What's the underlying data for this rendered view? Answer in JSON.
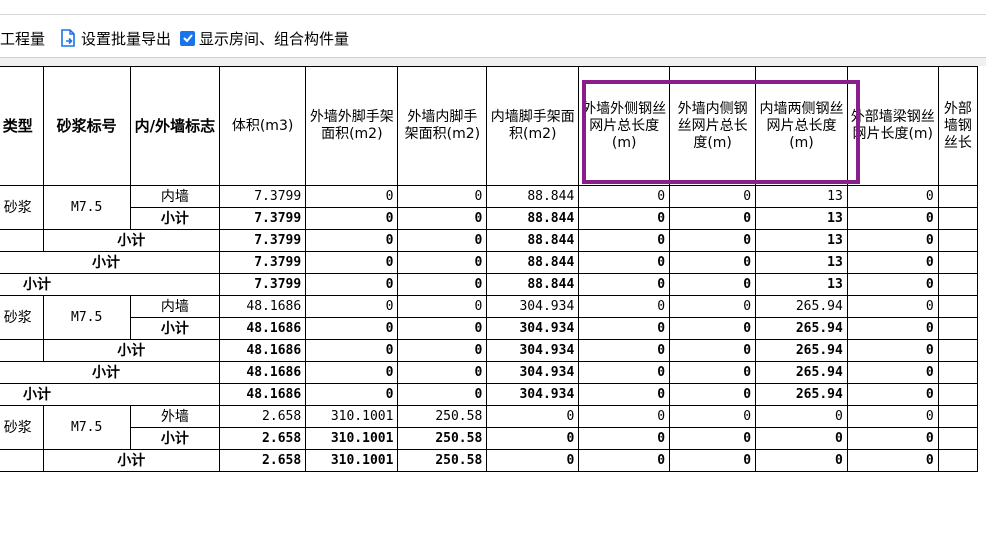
{
  "toolbar": {
    "quantities_label": "工程量",
    "batch_export_label": "设置批量导出",
    "show_rooms_label": "显示房间、组合构件量",
    "show_rooms_checked": true
  },
  "headers": [
    "类型",
    "砂浆标号",
    "内/外墙标志",
    "体积(m3)",
    "外墙外脚手架面积(m2)",
    "外墙内脚手架面积(m2)",
    "内墙脚手架面积(m2)",
    "外墙外侧钢丝网片总长度(m)",
    "外墙内侧钢丝网片总长度(m)",
    "内墙两侧钢丝网片总长度(m)",
    "外部墙梁钢丝网片长度(m)",
    "外部墙钢丝长"
  ],
  "labels": {
    "type_mortar": "砂浆",
    "grade": "M7.5",
    "inner_wall": "内墙",
    "outer_wall": "外墙",
    "subtotal": "小计"
  },
  "group1": {
    "detail": [
      "7.3799",
      "0",
      "0",
      "88.844",
      "0",
      "0",
      "13",
      "0"
    ],
    "subtotal": [
      "7.3799",
      "0",
      "0",
      "88.844",
      "0",
      "0",
      "13",
      "0"
    ]
  },
  "group2": {
    "detail": [
      "48.1686",
      "0",
      "0",
      "304.934",
      "0",
      "0",
      "265.94",
      "0"
    ],
    "subtotal": [
      "48.1686",
      "0",
      "0",
      "304.934",
      "0",
      "0",
      "265.94",
      "0"
    ]
  },
  "group3": {
    "detail": [
      "2.658",
      "310.1001",
      "250.58",
      "0",
      "0",
      "0",
      "0",
      "0"
    ],
    "subtotal": [
      "2.658",
      "310.1001",
      "250.58",
      "0",
      "0",
      "0",
      "0",
      "0"
    ]
  },
  "highlight_color": "#8a1d8c",
  "checkbox_color": "#1a73e8"
}
